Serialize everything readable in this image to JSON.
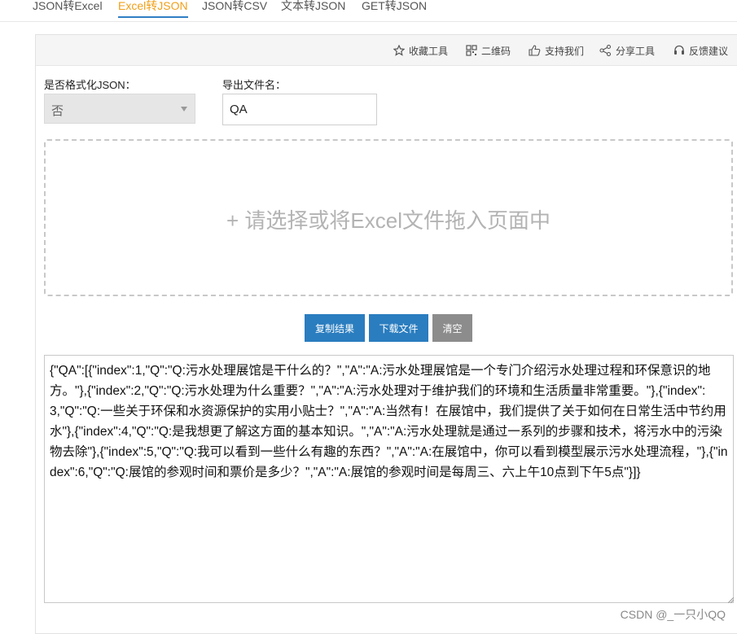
{
  "tabs": [
    "JSON转Excel",
    "Excel转JSON",
    "JSON转CSV",
    "文本转JSON",
    "GET转JSON"
  ],
  "active_tab": "Excel转JSON",
  "toolbar": {
    "favorite": "收藏工具",
    "qrcode": "二维码",
    "support": "支持我们",
    "share": "分享工具",
    "feedback": "反馈建议"
  },
  "form": {
    "format_label": "是否格式化JSON：",
    "format_value": "否",
    "filename_label": "导出文件名：",
    "filename_value": "QA"
  },
  "dropzone": {
    "text": "+ 请选择或将Excel文件拖入页面中"
  },
  "buttons": {
    "copy": "复制结果",
    "download": "下载文件",
    "clear": "清空"
  },
  "result": "{\"QA\":[{\"index\":1,\"Q\":\"Q:污水处理展馆是干什么的？\",\"A\":\"A:污水处理展馆是一个专门介绍污水处理过程和环保意识的地方。\"},{\"index\":2,\"Q\":\"Q:污水处理为什么重要？\",\"A\":\"A:污水处理对于维护我们的环境和生活质量非常重要。\"},{\"index\":3,\"Q\":\"Q:一些关于环保和水资源保护的实用小贴士？\",\"A\":\"A:当然有！在展馆中，我们提供了关于如何在日常生活中节约用水\"},{\"index\":4,\"Q\":\"Q:是我想更了解这方面的基本知识。\",\"A\":\"A:污水处理就是通过一系列的步骤和技术，将污水中的污染物去除\"},{\"index\":5,\"Q\":\"Q:我可以看到一些什么有趣的东西？\",\"A\":\"A:在展馆中，你可以看到模型展示污水处理流程，\"},{\"index\":6,\"Q\":\"Q:展馆的参观时间和票价是多少？\",\"A\":\"A:展馆的参观时间是每周三、六上午10点到下午5点\"}]}",
  "watermark": "CSDN @_一只小QQ",
  "colors": {
    "active_tab_text": "#f0a019",
    "active_tab_underline": "#2f7ec3",
    "button_blue": "#2a7dbf",
    "button_gray": "#8c8c8c"
  }
}
